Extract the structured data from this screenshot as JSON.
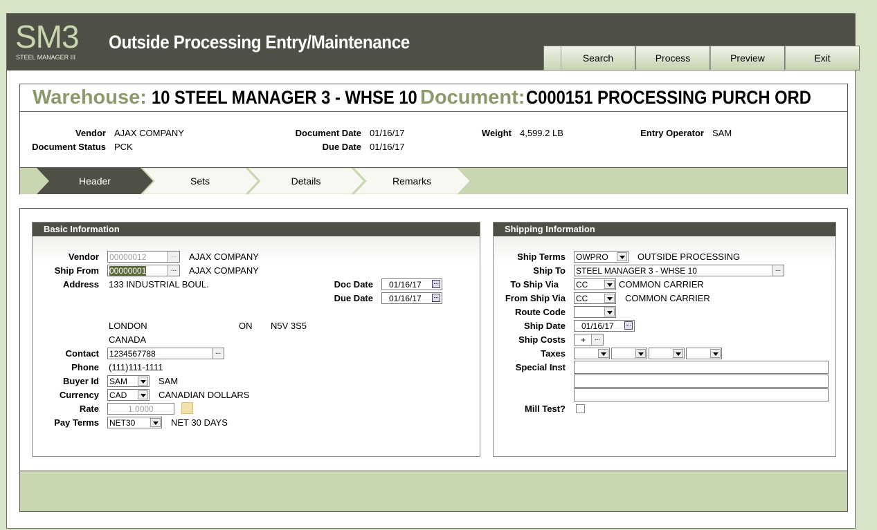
{
  "app": {
    "logo": "SM3",
    "logo_sub": "STEEL MANAGER III",
    "title": "Outside Processing Entry/Maintenance"
  },
  "toolbar": {
    "search": "Search",
    "process": "Process",
    "preview": "Preview",
    "exit": "Exit"
  },
  "doc": {
    "warehouse_label": "Warehouse:",
    "warehouse_value": "10 STEEL MANAGER 3 - WHSE 10",
    "document_label": "Document:",
    "document_value": "C000151 PROCESSING PURCH ORD",
    "vendor_label": "Vendor",
    "vendor_value": "AJAX COMPANY",
    "status_label": "Document Status",
    "status_value": "PCK",
    "docdate_label": "Document Date",
    "docdate_value": "01/16/17",
    "duedate_label": "Due Date",
    "duedate_value": "01/16/17",
    "weight_label": "Weight",
    "weight_value": "4,599.2 LB",
    "operator_label": "Entry Operator",
    "operator_value": "SAM"
  },
  "tabs": {
    "header": "Header",
    "sets": "Sets",
    "details": "Details",
    "remarks": "Remarks"
  },
  "basic": {
    "title": "Basic Information",
    "vendor_label": "Vendor",
    "vendor_code": "00000012",
    "vendor_name": "AJAX COMPANY",
    "shipfrom_label": "Ship From",
    "shipfrom_code": "00000001",
    "shipfrom_name": "AJAX COMPANY",
    "address_label": "Address",
    "address_line1": "133 INDUSTRIAL BOUL.",
    "docdate_label": "Doc Date",
    "docdate_value": "01/16/17",
    "duedate_label": "Due Date",
    "duedate_value": "01/16/17",
    "city": "LONDON",
    "province": "ON",
    "postal": "N5V 3S5",
    "country": "CANADA",
    "contact_label": "Contact",
    "contact_value": "1234567788",
    "phone_label": "Phone",
    "phone_value": "(111)111-1111",
    "buyer_label": "Buyer Id",
    "buyer_code": "SAM",
    "buyer_name": "SAM",
    "currency_label": "Currency",
    "currency_code": "CAD",
    "currency_name": "CANADIAN DOLLARS",
    "rate_label": "Rate",
    "rate_value": "1.0000",
    "payterms_label": "Pay Terms",
    "payterms_code": "NET30",
    "payterms_name": "NET 30 DAYS"
  },
  "shipping": {
    "title": "Shipping Information",
    "shipterms_label": "Ship Terms",
    "shipterms_code": "OWPRO",
    "shipterms_name": "OUTSIDE PROCESSING",
    "shipto_label": "Ship To",
    "shipto_value": "STEEL MANAGER 3 - WHSE 10",
    "toshipvia_label": "To Ship Via",
    "toshipvia_code": "CC",
    "toshipvia_name": "COMMON CARRIER",
    "fromshipvia_label": "From Ship Via",
    "fromshipvia_code": "CC",
    "fromshipvia_name": "COMMON CARRIER",
    "routecode_label": "Route Code",
    "shipdate_label": "Ship Date",
    "shipdate_value": "01/16/17",
    "shipcosts_label": "Ship Costs",
    "shipcosts_value": "+",
    "taxes_label": "Taxes",
    "specialinst_label": "Special Inst",
    "milltest_label": "Mill Test?"
  }
}
